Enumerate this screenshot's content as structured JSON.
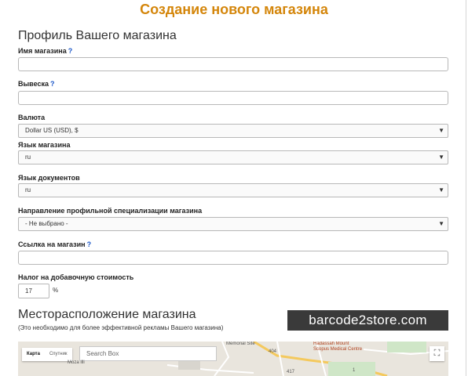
{
  "title": "Создание нового магазина",
  "profile": {
    "heading": "Профиль Вашего магазина",
    "shop_name": {
      "label": "Имя магазина",
      "help": "?",
      "value": ""
    },
    "signboard": {
      "label": "Вывеска",
      "help": "?",
      "value": ""
    },
    "currency": {
      "label": "Валюта",
      "selected": "Dollar US (USD), $",
      "arrow": "▼"
    },
    "shop_language": {
      "label": "Язык магазина",
      "selected": "ru",
      "arrow": "▼"
    },
    "doc_language": {
      "label": "Язык документов",
      "selected": "ru",
      "arrow": "▼"
    },
    "specialization": {
      "label": "Направление профильной специализации магазина",
      "selected": "- Не выбрано -",
      "arrow": "▼"
    },
    "shop_link": {
      "label": "Ссылка на магазин",
      "help": "?",
      "value": ""
    },
    "vat": {
      "label": "Налог на добавочную стоимость",
      "value": "17",
      "unit": "%"
    }
  },
  "location": {
    "heading": "Месторасположение магазина",
    "note": "(Это необходимо для более эффективной рекламы Вашего магазина)",
    "map": {
      "type_map": "Карта",
      "type_satellite": "Спутник",
      "search_placeholder": "Search Box",
      "fullscreen_glyph": "⛶",
      "labels": {
        "memorial_site": "Memorial Site",
        "hadassah": "Hadassah Mount",
        "hadassah2": "Scopus Medical Centre",
        "mozza": "Moza illi",
        "road_404": "404",
        "road_1": "1",
        "road_417": "417"
      }
    }
  },
  "watermark": "barcode2store.com"
}
